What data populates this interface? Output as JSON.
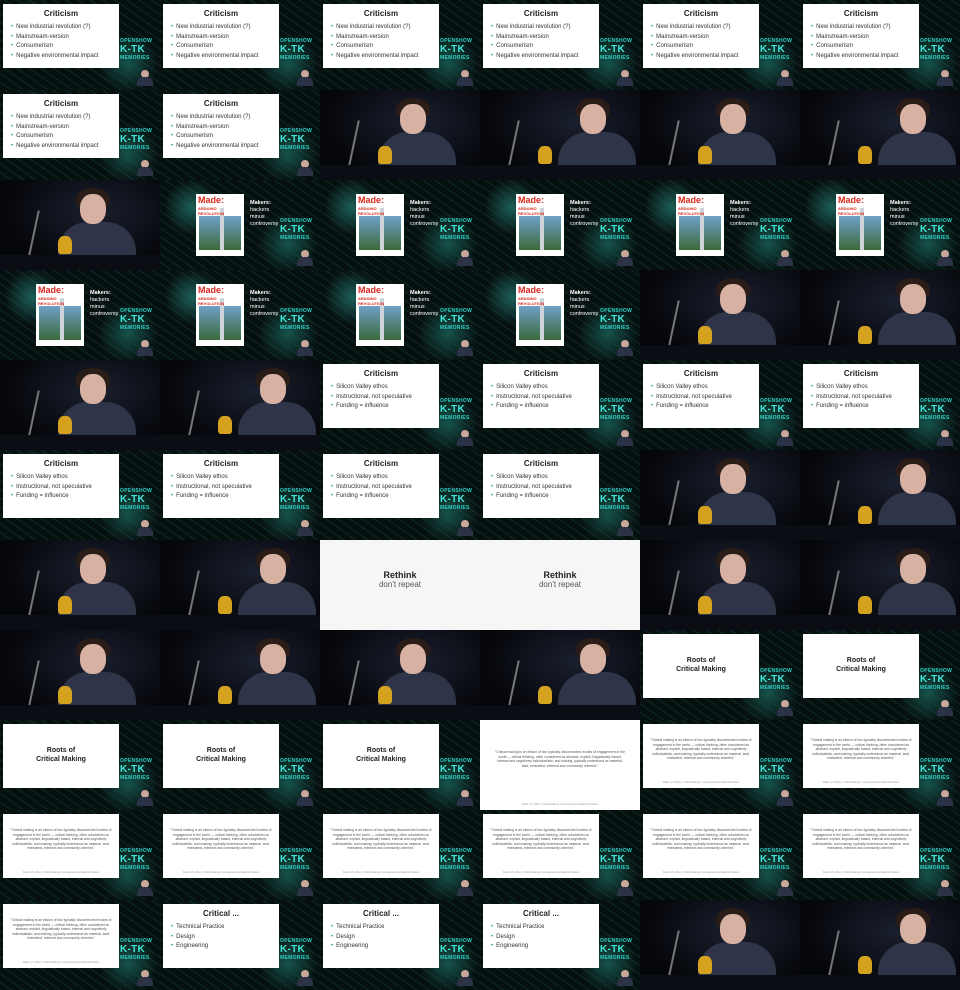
{
  "grid": {
    "columns": 6
  },
  "brand": {
    "line1": "OPENSHOW",
    "line2": "K-TK",
    "line3": "MEMORIES"
  },
  "slides": {
    "criticism_1": {
      "title": "Criticism",
      "bullets": [
        "New industrial revolution (?)",
        "Mainstream-version",
        "Consumerism",
        "Negative environmental impact"
      ]
    },
    "criticism_2": {
      "title": "Criticism",
      "bullets": [
        "Silicon Valley ethos",
        "Instructional, not speculative",
        "Funding = influence"
      ]
    },
    "magazine": {
      "name": "Made:",
      "headline": "ARDUINO REVOLUTION",
      "caption_title": "Makers:",
      "caption_lines": [
        "hackers",
        "minus",
        "controversy"
      ]
    },
    "rethink": {
      "title": "Rethink",
      "subtitle": "don't repeat"
    },
    "roots": {
      "line1": "Roots of",
      "line2": "Critical Making"
    },
    "quote": {
      "text": "\"Critical making is an elision of two typically disconnected modes of engagement in the world — critical thinking, often considered as abstract, explicit, linguistically based, internal and cognitively individualistic; and making, typically understood as material, tacit, embodied, external and community oriented.\"",
      "citation": "Ratto, M. (2011). Critical Making: Conceptual and Material Studies"
    },
    "critical": {
      "title": "Critical ...",
      "bullets": [
        "Technical Practice",
        "Design",
        "Engineering"
      ]
    }
  },
  "tiles": [
    {
      "type": "criticism_1"
    },
    {
      "type": "criticism_1"
    },
    {
      "type": "criticism_1"
    },
    {
      "type": "criticism_1"
    },
    {
      "type": "criticism_1"
    },
    {
      "type": "criticism_1"
    },
    {
      "type": "criticism_1"
    },
    {
      "type": "criticism_1"
    },
    {
      "type": "speaker"
    },
    {
      "type": "speaker"
    },
    {
      "type": "speaker"
    },
    {
      "type": "speaker"
    },
    {
      "type": "speaker"
    },
    {
      "type": "magazine"
    },
    {
      "type": "magazine"
    },
    {
      "type": "magazine"
    },
    {
      "type": "magazine"
    },
    {
      "type": "magazine"
    },
    {
      "type": "magazine"
    },
    {
      "type": "magazine"
    },
    {
      "type": "magazine"
    },
    {
      "type": "magazine"
    },
    {
      "type": "speaker"
    },
    {
      "type": "speaker"
    },
    {
      "type": "speaker"
    },
    {
      "type": "speaker"
    },
    {
      "type": "criticism_2"
    },
    {
      "type": "criticism_2"
    },
    {
      "type": "criticism_2"
    },
    {
      "type": "criticism_2"
    },
    {
      "type": "criticism_2"
    },
    {
      "type": "criticism_2"
    },
    {
      "type": "criticism_2"
    },
    {
      "type": "criticism_2"
    },
    {
      "type": "speaker"
    },
    {
      "type": "speaker"
    },
    {
      "type": "speaker"
    },
    {
      "type": "speaker"
    },
    {
      "type": "rethink_wide"
    },
    {
      "type": "skip"
    },
    {
      "type": "speaker"
    },
    {
      "type": "speaker"
    },
    {
      "type": "speaker"
    },
    {
      "type": "speaker"
    },
    {
      "type": "speaker"
    },
    {
      "type": "speaker"
    },
    {
      "type": "roots"
    },
    {
      "type": "roots"
    },
    {
      "type": "roots"
    },
    {
      "type": "roots"
    },
    {
      "type": "roots"
    },
    {
      "type": "quote_wide"
    },
    {
      "type": "quote"
    },
    {
      "type": "quote"
    },
    {
      "type": "quote"
    },
    {
      "type": "quote"
    },
    {
      "type": "quote"
    },
    {
      "type": "quote"
    },
    {
      "type": "quote"
    },
    {
      "type": "quote"
    },
    {
      "type": "quote"
    },
    {
      "type": "critical"
    },
    {
      "type": "critical"
    },
    {
      "type": "critical"
    },
    {
      "type": "speaker"
    },
    {
      "type": "speaker"
    }
  ]
}
